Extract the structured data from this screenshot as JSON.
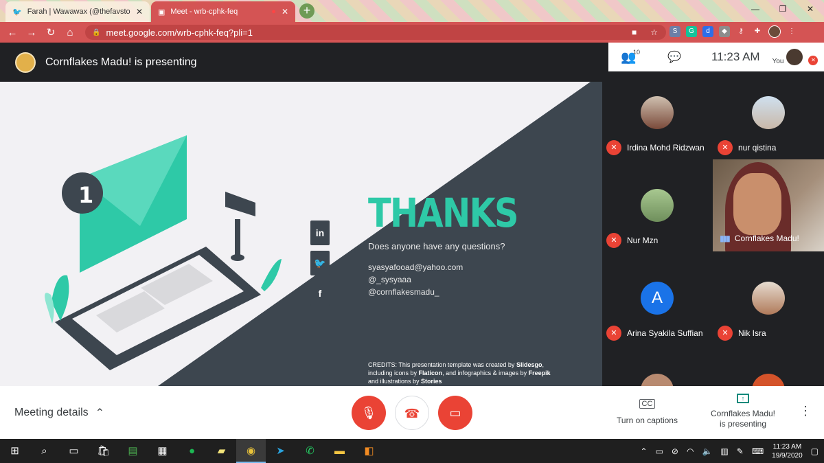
{
  "browser": {
    "tabs": [
      {
        "title": "Farah | Wawawax (@thefavstop)",
        "icon": "twitter-icon"
      },
      {
        "title": "Meet - wrb-cphk-feq",
        "icon": "meet-icon"
      }
    ],
    "url": "meet.google.com/wrb-cphk-feq?pli=1"
  },
  "meet": {
    "presenting_title": "Cornflakes Madu! is presenting",
    "participant_count": "10",
    "time": "11:23 AM",
    "you_label": "You"
  },
  "slide": {
    "thanks": "THANKS",
    "question": "Does anyone have any questions?",
    "contacts": [
      "syasyafooad@yahoo.com",
      "@_sysyaaa",
      "@cornflakesmadu_"
    ],
    "badge": "1",
    "credits": {
      "p1": "CREDITS: This presentation template was created by ",
      "slidesgo": "Slidesgo",
      "p2": ", including icons by ",
      "flaticon": "Flaticon",
      "p3": ", and infographics & images by ",
      "freepik": "Freepik",
      "p4": " and illustrations by ",
      "stories": "Stories"
    },
    "social": [
      "in",
      "🐦",
      "f"
    ]
  },
  "participants": [
    {
      "name": "Irdina Mohd Ridzwan",
      "muted": true
    },
    {
      "name": "nur qistina",
      "muted": true
    },
    {
      "name": "Nur Mzn",
      "muted": true
    },
    {
      "name": "Arina Syakila Suffian",
      "muted": true,
      "initial": "A"
    },
    {
      "name": "Nik Isra",
      "muted": true
    }
  ],
  "presenter_tile": {
    "name": "Cornflakes Madu!"
  },
  "controls": {
    "meeting_details": "Meeting details",
    "captions": "Turn on captions",
    "presenting_line1": "Cornflakes Madu!",
    "presenting_line2": "is presenting"
  },
  "taskbar": {
    "time": "11:23 AM",
    "date": "19/9/2020"
  },
  "colors": {
    "accent": "#2ec9a7",
    "danger": "#ea4335",
    "browser_red": "#d45454"
  }
}
